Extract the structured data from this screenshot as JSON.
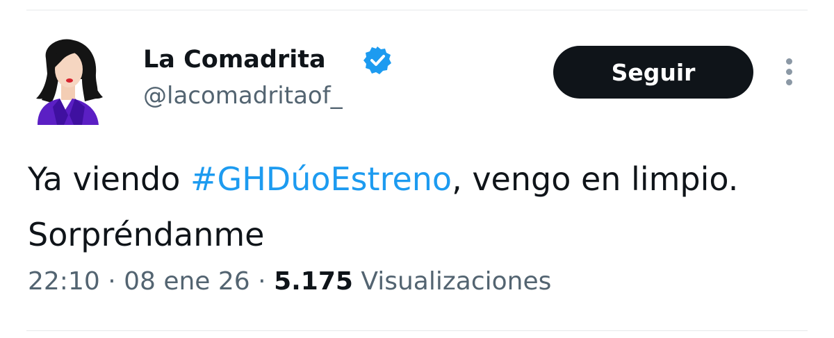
{
  "tweet": {
    "author": {
      "display_name": "La Comadrita",
      "handle": "@lacomadritaof_",
      "verified_icon": "verified-badge-icon",
      "avatar": "woman-illustration-avatar"
    },
    "follow_button_label": "Seguir",
    "more_icon": "more-options-vertical-dots-icon",
    "text": {
      "prefix": "Ya viendo ",
      "hashtag": "#GHDúoEstreno",
      "suffix": ", vengo en limpio. Sorpréndanme"
    },
    "meta": {
      "time": "22:10",
      "separator_1": " · ",
      "date": "08 ene 26",
      "separator_2": " · ",
      "views_count": "5.175",
      "views_label": " Visualizaciones"
    }
  },
  "colors": {
    "text_primary": "#0f1419",
    "text_secondary": "#536471",
    "link": "#1d9bf0",
    "verified": "#1d9bf0",
    "button_bg": "#0f1419",
    "button_text": "#ffffff",
    "divider": "#e6e9eb"
  }
}
